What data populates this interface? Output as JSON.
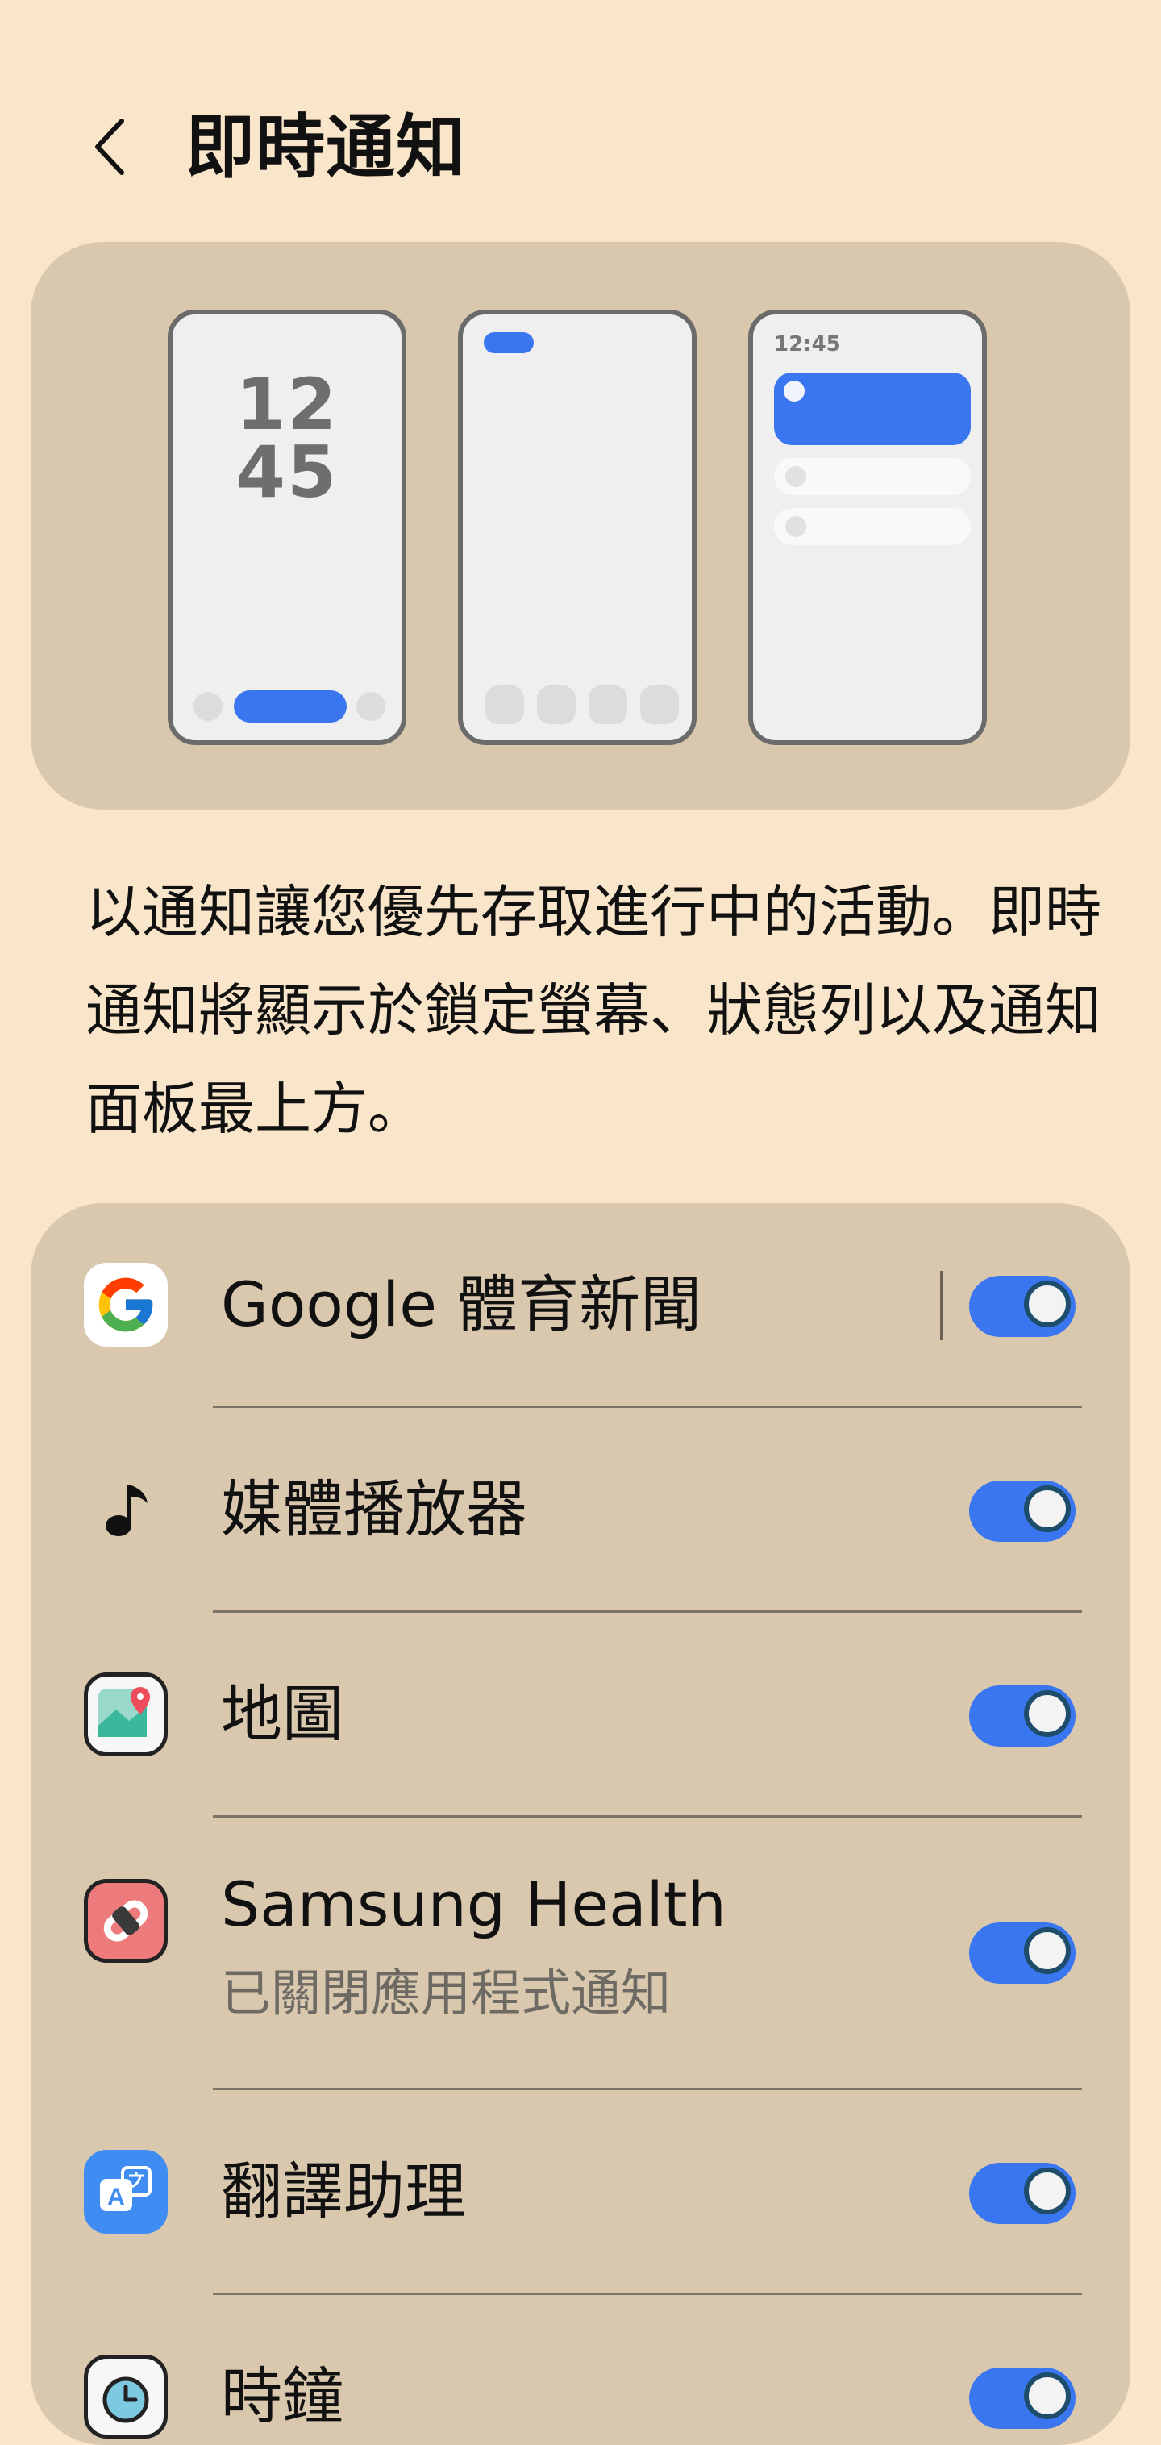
{
  "header": {
    "title": "即時通知",
    "back_icon": "chevron-left-icon"
  },
  "illustration": {
    "lockscreen_clock": [
      "12",
      "45"
    ],
    "panel_status_time": "12:45"
  },
  "description": "以通知讓您優先存取進行中的活動。即時通知將顯示於鎖定螢幕、狀態列以及通知面板最上方。",
  "apps": [
    {
      "name": "Google 體育新聞",
      "icon": "google-icon",
      "enabled": true
    },
    {
      "name": "媒體播放器",
      "icon": "music-note-icon",
      "enabled": true
    },
    {
      "name": "地圖",
      "icon": "maps-icon",
      "enabled": true
    },
    {
      "name": "Samsung Health",
      "subtitle": "已關閉應用程式通知",
      "icon": "samsung-health-icon",
      "enabled": true
    },
    {
      "name": "翻譯助理",
      "icon": "translate-icon",
      "enabled": true
    },
    {
      "name": "時鐘",
      "icon": "clock-icon",
      "enabled": true
    }
  ],
  "colors": {
    "background": "#f9e5c9",
    "card": "#d9c8ae",
    "accent": "#3a76f0"
  }
}
